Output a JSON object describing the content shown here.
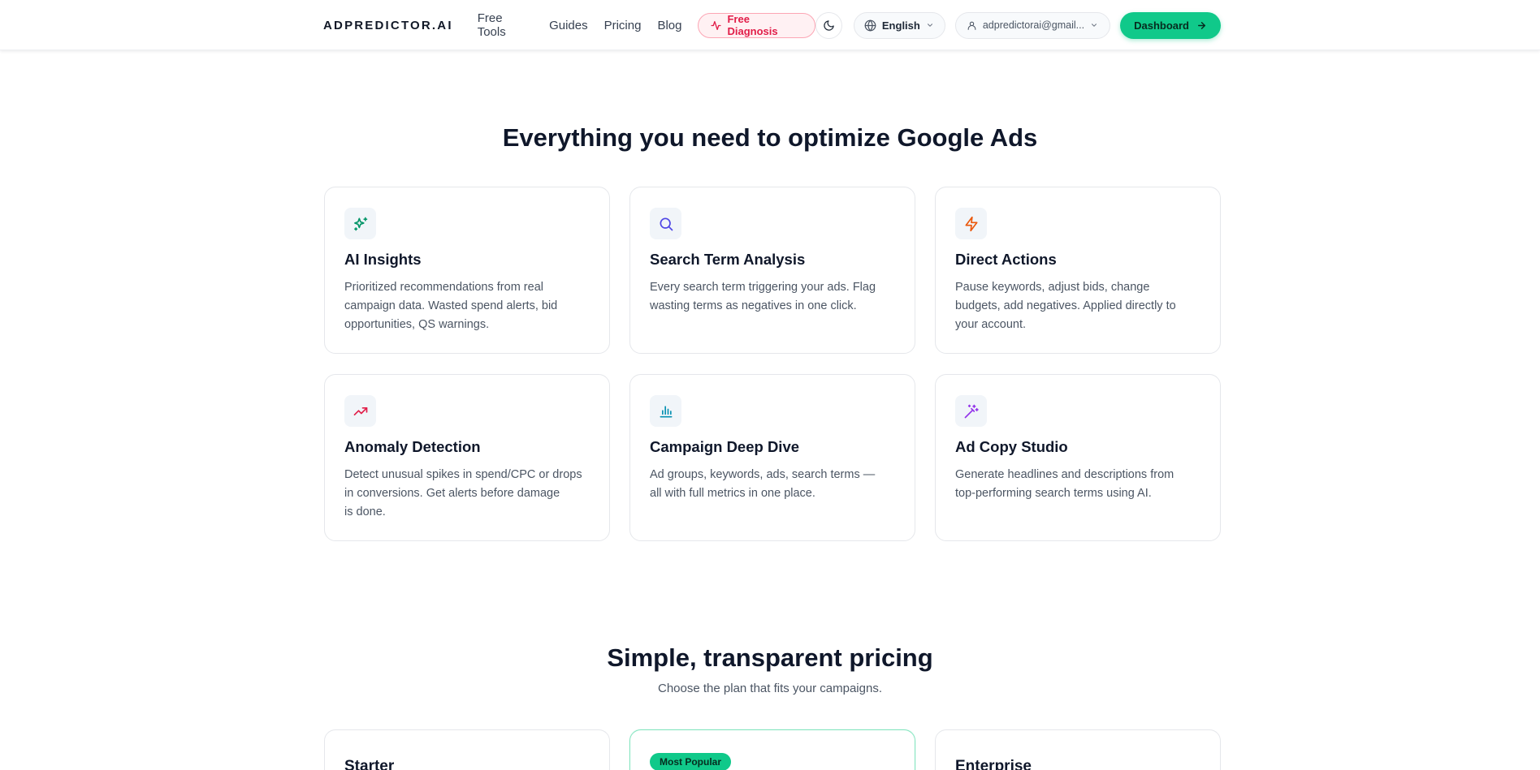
{
  "header": {
    "logo": "ADPREDICTOR.AI",
    "nav": [
      "Free Tools",
      "Guides",
      "Pricing",
      "Blog"
    ],
    "diagnosis_label": "Free Diagnosis",
    "language": "English",
    "user_email": "adpredictorai@gmail...",
    "dashboard_label": "Dashboard"
  },
  "features": {
    "title": "Everything you need to optimize Google Ads",
    "cards": [
      {
        "icon": "sparkles-icon",
        "icon_color": "#059669",
        "title": "AI Insights",
        "desc_lines": [
          "Prioritized recommendations from real",
          "campaign data. Wasted spend alerts, bid",
          "opportunities, QS warnings."
        ]
      },
      {
        "icon": "search-icon",
        "icon_color": "#4f46e5",
        "title": "Search Term Analysis",
        "desc_lines": [
          "Every search term triggering your ads. Flag",
          "wasting terms as negatives in one click."
        ]
      },
      {
        "icon": "zap-icon",
        "icon_color": "#ea580c",
        "title": "Direct Actions",
        "desc_lines": [
          "Pause keywords, adjust bids, change",
          "budgets, add negatives. Applied directly to",
          "your account."
        ]
      },
      {
        "icon": "trending-up-icon",
        "icon_color": "#e11d48",
        "title": "Anomaly Detection",
        "desc_lines": [
          "Detect unusual spikes in spend/CPC or drops",
          "in conversions. Get alerts before damage",
          "is done."
        ]
      },
      {
        "icon": "bar-chart-icon",
        "icon_color": "#0891b2",
        "title": "Campaign Deep Dive",
        "desc_lines": [
          "Ad groups, keywords, ads, search terms —",
          "all with full metrics in one place."
        ]
      },
      {
        "icon": "magic-wand-icon",
        "icon_color": "#9333ea",
        "title": "Ad Copy Studio",
        "desc_lines": [
          "Generate headlines and descriptions from",
          "top-performing search terms using AI."
        ]
      }
    ]
  },
  "pricing": {
    "title": "Simple, transparent pricing",
    "subtitle": "Choose the plan that fits your campaigns.",
    "plans": [
      {
        "name": "Starter"
      },
      {
        "badge": "Most Popular"
      },
      {
        "name": "Enterprise"
      }
    ]
  },
  "colors": {
    "accent": "#10c98a",
    "diagnosis": "#e11d48"
  }
}
